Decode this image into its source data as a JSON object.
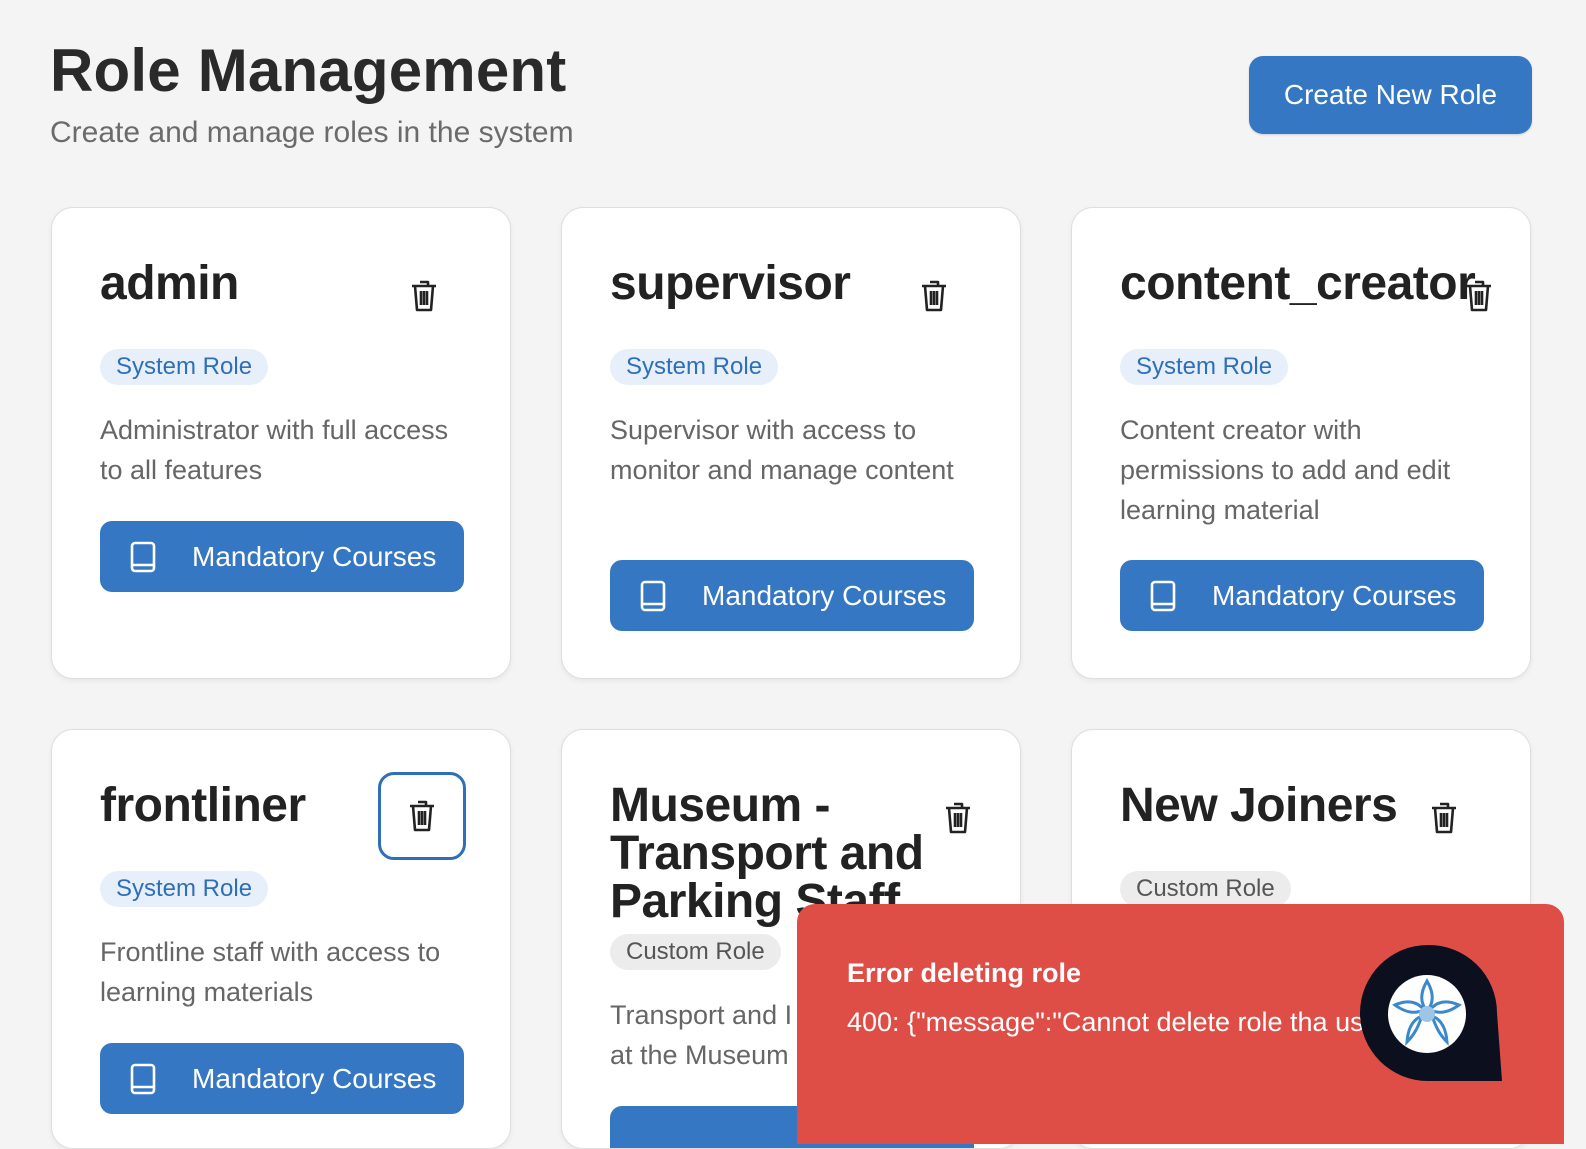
{
  "header": {
    "title": "Role Management",
    "subtitle": "Create and manage roles in the system",
    "create_button_label": "Create New Role"
  },
  "roles": [
    {
      "name": "admin",
      "badge": "System Role",
      "description": "Administrator with full access to all features",
      "courses_label": "Mandatory Courses"
    },
    {
      "name": "supervisor",
      "badge": "System Role",
      "description": "Supervisor with access to monitor and manage content",
      "courses_label": "Mandatory Courses"
    },
    {
      "name": "content_creator",
      "badge": "System Role",
      "description": "Content creator with permissions to add and edit learning material",
      "courses_label": "Mandatory Courses"
    },
    {
      "name": "frontliner",
      "badge": "System Role",
      "description": "Frontline staff with access to learning materials",
      "courses_label": "Mandatory Courses"
    },
    {
      "name": "Museum - Transport and Parking Staff",
      "badge": "Custom Role",
      "description": "Transport and I at the Museum"
    },
    {
      "name": "New Joiners",
      "badge": "Custom Role"
    }
  ],
  "toast": {
    "title": "Error deleting role",
    "message": "400: {\"message\":\"Cannot delete role tha use\"}"
  },
  "icons": {
    "delete": "trash-icon",
    "courses": "book-icon",
    "chat": "chat-assistant-icon"
  },
  "colors": {
    "primary": "#3577c2",
    "error": "#de4e47",
    "system_badge_bg": "#e7f0fa",
    "custom_badge_bg": "#ececec"
  }
}
